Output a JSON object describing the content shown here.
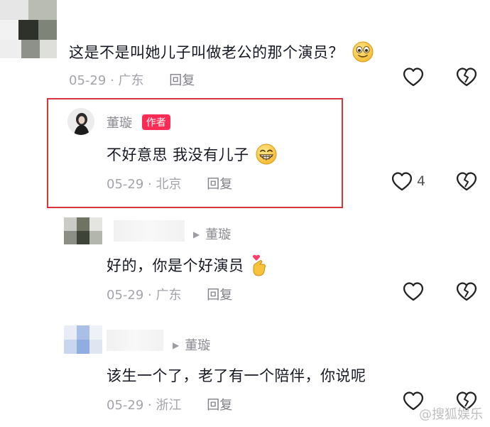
{
  "comments": [
    {
      "text": "这是不是叫她儿子叫做老公的那个演员？",
      "date": "05-29",
      "location": "广东",
      "reply_label": "回复"
    },
    {
      "username": "董璇",
      "badge": "作者",
      "text": "不好意思 我没有儿子",
      "date": "05-29",
      "location": "北京",
      "reply_label": "回复",
      "like_count": "4"
    },
    {
      "reply_to": "董璇",
      "text": "好的，你是个好演员",
      "date": "05-29",
      "location": "广东",
      "reply_label": "回复"
    },
    {
      "reply_to": "董璇",
      "text": "该生一个了，老了有一个陪伴，你说呢",
      "date": "05-29",
      "location": "浙江",
      "reply_label": "回复"
    }
  ],
  "watermark": "@搜狐娱乐",
  "icons": [
    "smile-emoji-icon",
    "grin-emoji-icon",
    "finger-heart-emoji-icon",
    "heart-outline-icon",
    "broken-heart-icon"
  ],
  "colors": {
    "author_badge": "#fe2c55",
    "highlight_border": "#d9343c",
    "meta_text": "#a3a4aa"
  }
}
